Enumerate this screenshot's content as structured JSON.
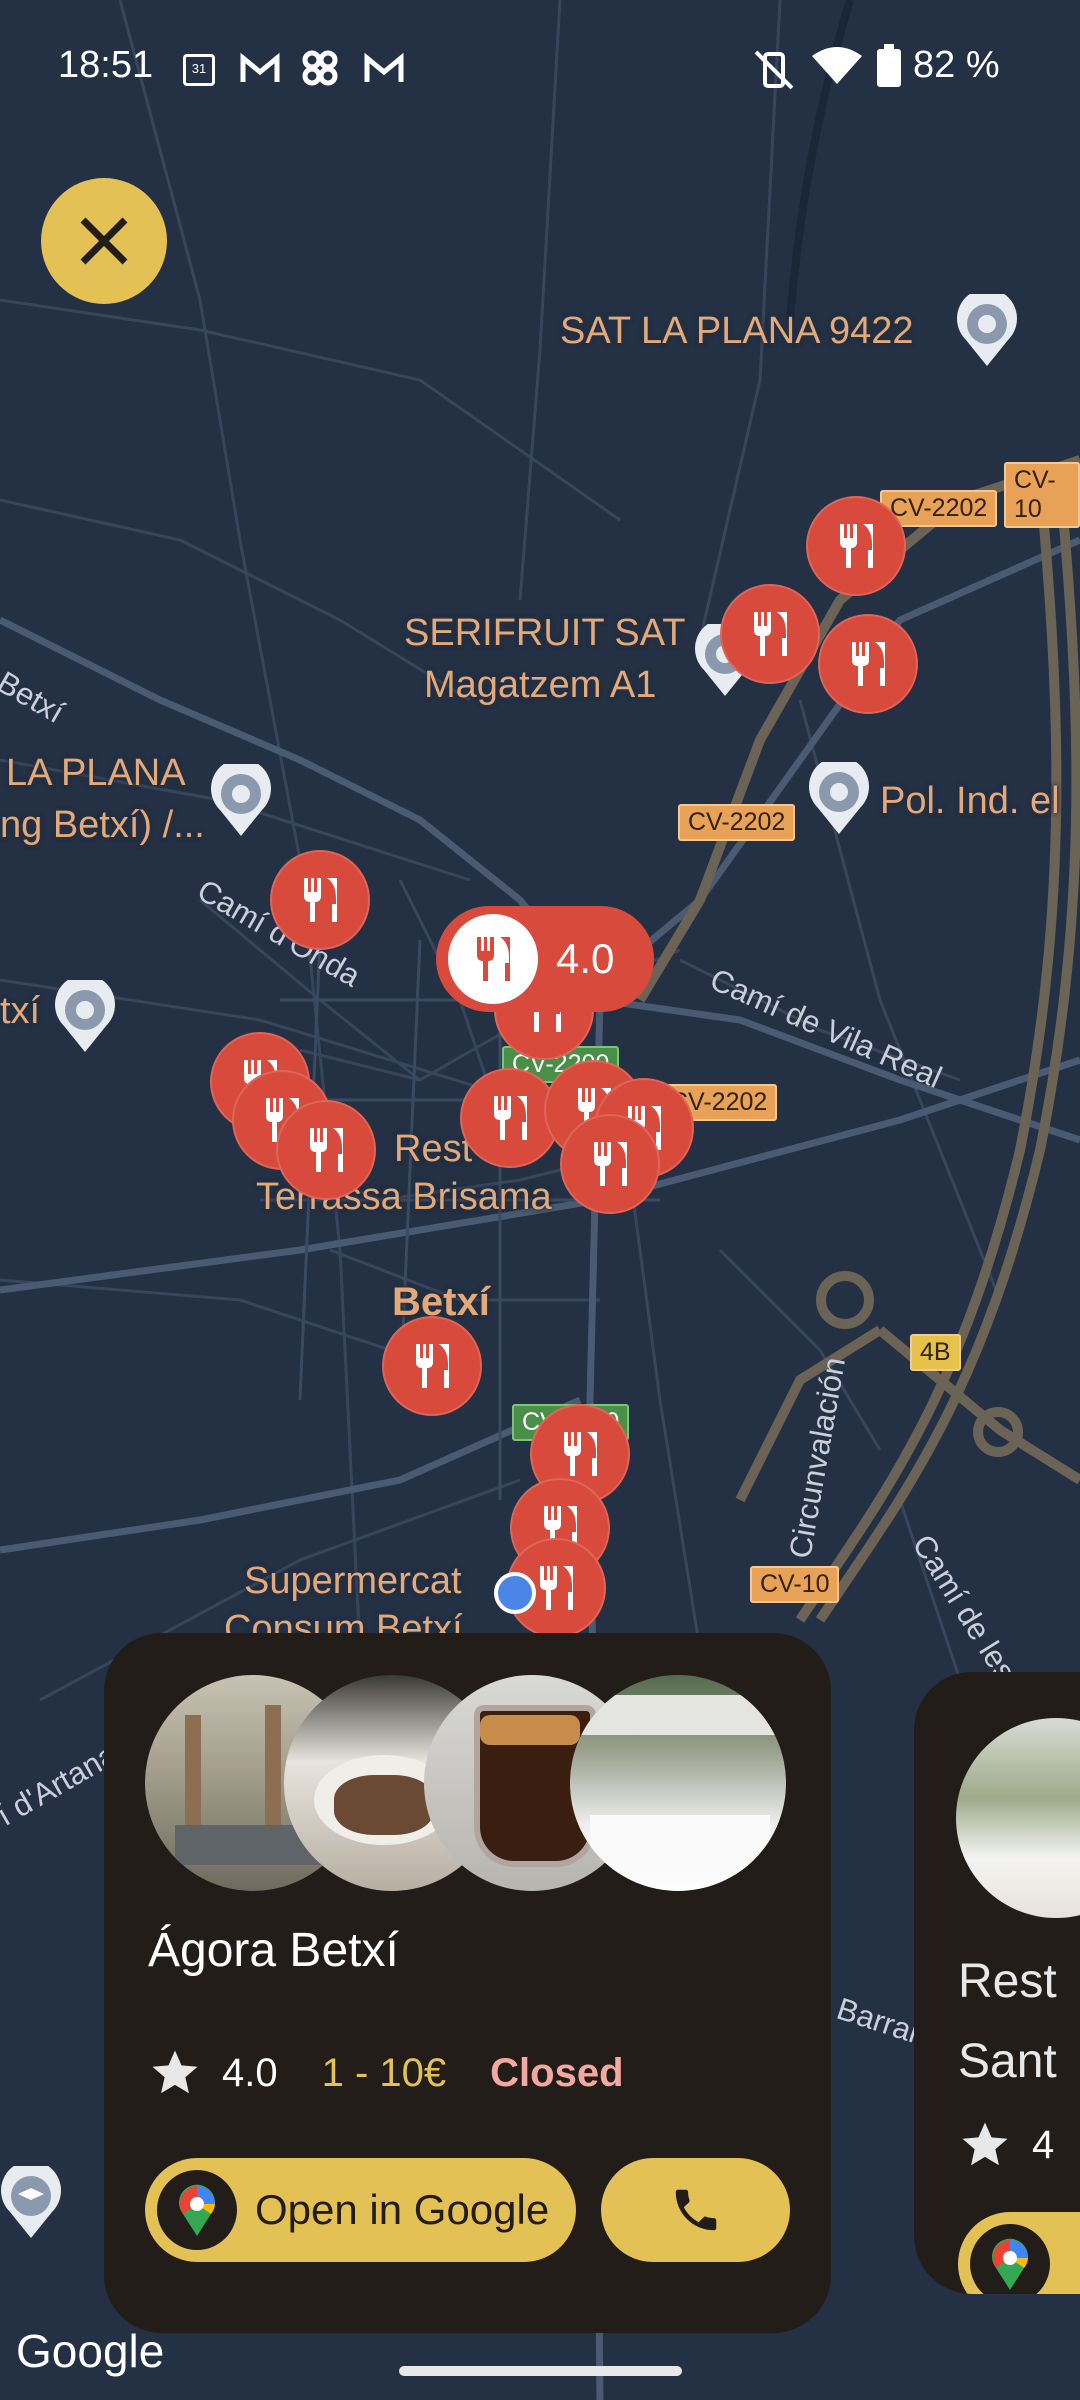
{
  "status_bar": {
    "time": "18:51",
    "battery": "82 %"
  },
  "map": {
    "places": [
      {
        "id": "sat",
        "label": "SAT LA PLANA 9422"
      },
      {
        "id": "serifruit1",
        "label": "SERIFRUIT SAT"
      },
      {
        "id": "serifruit2",
        "label": "Magatzem A1"
      },
      {
        "id": "laplana1",
        "label": "LA PLANA"
      },
      {
        "id": "laplana2",
        "label": "ng Betxí) /..."
      },
      {
        "id": "xi",
        "label": "txí"
      },
      {
        "id": "polind",
        "label": "Pol. Ind. el"
      },
      {
        "id": "rest",
        "label": "Rest"
      },
      {
        "id": "terrassa",
        "label": "Terrassa Brisama"
      },
      {
        "id": "betxi",
        "label": "Betxí"
      },
      {
        "id": "super1",
        "label": "Supermercat"
      },
      {
        "id": "super2",
        "label": "Consum Betxí"
      }
    ],
    "roads": [
      {
        "id": "betxi_road",
        "label": "Betxí"
      },
      {
        "id": "onda",
        "label": "Camí d'Onda"
      },
      {
        "id": "vilareal",
        "label": "Camí de Vila Real"
      },
      {
        "id": "circ",
        "label": "Circunvalación"
      },
      {
        "id": "vinyes",
        "label": "Camí de les Vinyes"
      },
      {
        "id": "artana",
        "label": "í d'Artana"
      },
      {
        "id": "barranc",
        "label": "Barranc de les Ca"
      }
    ],
    "shields": [
      "CV-2202",
      "CV-10",
      "CV-2202",
      "CV-2200",
      "CV-2202",
      "4B",
      "CV-2200",
      "CV-10"
    ],
    "selected_rating": "4.0"
  },
  "card": {
    "name": "Ágora Betxí",
    "rating": "4.0",
    "price": "1 - 10€",
    "status": "Closed",
    "open_label": "Open in Google"
  },
  "card2": {
    "name_line1": "Rest",
    "name_line2": "Sant",
    "rating": "4"
  },
  "footer": {
    "google_logo": "Google"
  },
  "colors": {
    "accent": "#e3c154",
    "pin": "#d84b3c",
    "closed": "#f4a9a0",
    "price": "#e3c154"
  }
}
